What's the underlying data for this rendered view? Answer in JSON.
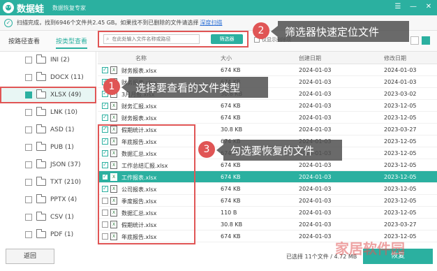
{
  "app": {
    "name": "数据蛙",
    "subtitle": "数据恢复专家",
    "window_controls": [
      "☰",
      "—",
      "✕"
    ]
  },
  "status": {
    "text": "扫描完成，找到6946个文件共2.45 GB。如果找不到已删除的文件请选择",
    "link": "深度扫描"
  },
  "tabs": [
    {
      "label": "按路径查看",
      "active": false
    },
    {
      "label": "按类型查看",
      "active": true
    }
  ],
  "filter": {
    "placeholder": "在此处输入文件名称或路径",
    "button": "筛选器",
    "only_deleted_label": "仅显示删除项"
  },
  "sidebar": {
    "items": [
      {
        "label": "INI (2)",
        "selected": false
      },
      {
        "label": "DOCX (11)",
        "selected": false
      },
      {
        "label": "XLSX (49)",
        "selected": true
      },
      {
        "label": "LNK (10)",
        "selected": false
      },
      {
        "label": "ASD (1)",
        "selected": false
      },
      {
        "label": "PUB (1)",
        "selected": false
      },
      {
        "label": "JSON (37)",
        "selected": false
      },
      {
        "label": "TXT (210)",
        "selected": false
      },
      {
        "label": "PPTX (4)",
        "selected": false
      },
      {
        "label": "CSV (1)",
        "selected": false
      },
      {
        "label": "PDF (1)",
        "selected": false
      }
    ],
    "back_button": "返回"
  },
  "table": {
    "headers": {
      "name": "名称",
      "size": "大小",
      "created": "创建日期",
      "modified": "修改日期"
    },
    "rows": [
      {
        "checked": true,
        "name": "财务报表.xlsx",
        "size": "674 KB",
        "created": "2024-01-03",
        "modified": "2024-01-03",
        "selected": false
      },
      {
        "checked": true,
        "name": "财务报表.xlsx",
        "size": "674 KB",
        "created": "2024-01-03",
        "modified": "2024-01-03",
        "selected": false
      },
      {
        "checked": true,
        "name": "3月月报.xlsx",
        "size": "30.8 KB",
        "created": "2024-01-03",
        "modified": "2023-03-02",
        "selected": false
      },
      {
        "checked": true,
        "name": "财务汇报.xlsx",
        "size": "674 KB",
        "created": "2024-01-03",
        "modified": "2023-12-05",
        "selected": false
      },
      {
        "checked": true,
        "name": "财务报表.xlsx",
        "size": "674 KB",
        "created": "2024-01-03",
        "modified": "2023-12-05",
        "selected": false
      },
      {
        "checked": true,
        "name": "假期统计.xlsx",
        "size": "30.8 KB",
        "created": "2024-01-03",
        "modified": "2023-03-27",
        "selected": false
      },
      {
        "checked": true,
        "name": "年底报告.xlsx",
        "size": "674 KB",
        "created": "2024-01-03",
        "modified": "2023-12-05",
        "selected": false
      },
      {
        "checked": true,
        "name": "数据汇总.xlsx",
        "size": "674 KB",
        "created": "2024-01-03",
        "modified": "2023-12-05",
        "selected": false
      },
      {
        "checked": true,
        "name": "工作总结汇报.xlsx",
        "size": "674 KB",
        "created": "2024-01-03",
        "modified": "2023-12-05",
        "selected": false
      },
      {
        "checked": true,
        "name": "工作报表.xlsx",
        "size": "674 KB",
        "created": "2024-01-03",
        "modified": "2023-12-05",
        "selected": true
      },
      {
        "checked": true,
        "name": "公司报表.xlsx",
        "size": "674 KB",
        "created": "2024-01-03",
        "modified": "2023-12-05",
        "selected": false
      },
      {
        "checked": false,
        "name": "季度报告.xlsx",
        "size": "674 KB",
        "created": "2024-01-03",
        "modified": "2023-12-05",
        "selected": false
      },
      {
        "checked": false,
        "name": "数据汇总.xlsx",
        "size": "110 B",
        "created": "2024-01-03",
        "modified": "2023-12-05",
        "selected": false
      },
      {
        "checked": false,
        "name": "假期统计.xlsx",
        "size": "30.8 KB",
        "created": "2024-01-03",
        "modified": "2023-03-27",
        "selected": false
      },
      {
        "checked": false,
        "name": "年底报告.xlsx",
        "size": "674 KB",
        "created": "2024-01-03",
        "modified": "2023-12-05",
        "selected": false
      }
    ]
  },
  "footer": {
    "summary": "已选择 11个文件 / 4.72 MB",
    "recover_button": "恢复"
  },
  "callouts": [
    {
      "number": "1",
      "text": "选择要查看的文件类型"
    },
    {
      "number": "2",
      "text": "筛选器快速定位文件"
    },
    {
      "number": "3",
      "text": "勾选要恢复的文件"
    }
  ],
  "watermark": "家居软件园",
  "colors": {
    "accent": "#2bb0a0",
    "highlight": "#e05555"
  }
}
